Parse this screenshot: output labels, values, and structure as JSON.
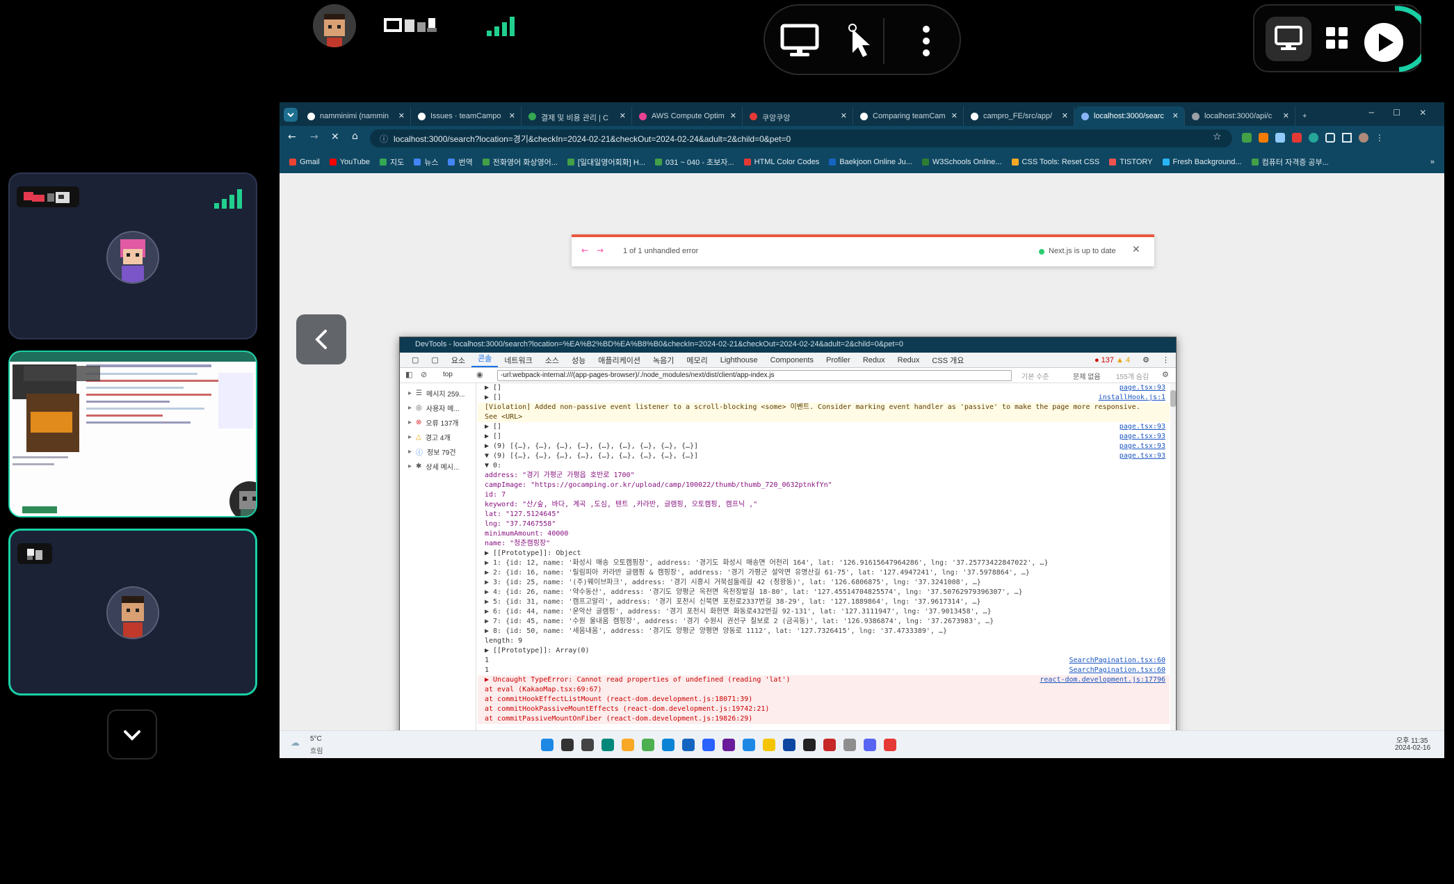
{
  "meeting": {
    "accent": "#19d0a6",
    "signal_color": "#22d08e",
    "controls": [
      {
        "icon": "monitor-icon"
      },
      {
        "icon": "pointer-icon"
      },
      {
        "icon": "more-vertical-icon"
      }
    ],
    "right_controls": [
      {
        "icon": "screen-share-icon"
      },
      {
        "icon": "grid-layout-icon"
      },
      {
        "icon": "play-record-icon"
      }
    ]
  },
  "browser": {
    "tabs": [
      {
        "label": "namminimi (nammin",
        "color": "#ffffff"
      },
      {
        "label": "Issues · teamCampo",
        "color": "#ffffff"
      },
      {
        "label": "결제 및 비용 관리 | C",
        "color": "#34a853"
      },
      {
        "label": "AWS Compute Optim",
        "color": "#e84393"
      },
      {
        "label": "쿠앙쿠앙",
        "color": "#e53935"
      },
      {
        "label": "Comparing teamCam",
        "color": "#ffffff"
      },
      {
        "label": "campro_FE/src/app/",
        "color": "#ffffff"
      },
      {
        "label": "localhost:3000/searc",
        "color": "#8ab4f8"
      },
      {
        "label": "localhost:3000/api/c",
        "color": "#9aa0a6"
      }
    ],
    "url": "localhost:3000/search?location=경기&checkIn=2024-02-21&checkOut=2024-02-24&adult=2&child=0&pet=0",
    "bookmarks": [
      {
        "label": "Gmail",
        "color": "#ea4335"
      },
      {
        "label": "YouTube",
        "color": "#ff0000"
      },
      {
        "label": "지도",
        "color": "#34a853"
      },
      {
        "label": "뉴스",
        "color": "#4285f4"
      },
      {
        "label": "번역",
        "color": "#4285f4"
      },
      {
        "label": "전화영어 화상영어...",
        "color": "#43a047"
      },
      {
        "label": "[일대일영어회화] H...",
        "color": "#43a047"
      },
      {
        "label": "031 ~ 040 - 초보자...",
        "color": "#43a047"
      },
      {
        "label": "HTML Color Codes",
        "color": "#e53935"
      },
      {
        "label": "Baekjoon Online Ju...",
        "color": "#1565c0"
      },
      {
        "label": "W3Schools Online...",
        "color": "#2e7d32"
      },
      {
        "label": "CSS Tools: Reset CSS",
        "color": "#f9a825"
      },
      {
        "label": "TISTORY",
        "color": "#ef5350"
      },
      {
        "label": "Fresh Background...",
        "color": "#29b6f6"
      },
      {
        "label": "컴퓨터 자격증 공부...",
        "color": "#43a047"
      }
    ]
  },
  "nextjs_error": {
    "text": "1 of 1 unhandled error",
    "status": "Next.js is up to date"
  },
  "devtools": {
    "title": "DevTools - localhost:3000/search?location=%EA%B2%BD%EA%B8%B0&checkIn=2024-02-21&checkOut=2024-02-24&adult=2&child=0&pet=0",
    "tabs": [
      "요소",
      "콘솔",
      "네트워크",
      "소스",
      "성능",
      "애플리케이션",
      "녹음기",
      "메모리",
      "Lighthouse",
      "Components",
      "Profiler",
      "Redux",
      "Redux",
      "CSS 개요"
    ],
    "active_tab": "콘솔",
    "error_count": "137",
    "warning_count": "4",
    "context": "top",
    "filter": "-url:webpack-internal:///(app-pages-browser)/./node_modules/next/dist/client/app-index.js",
    "level": "기본 수준",
    "issues": "문제 없음",
    "hidden": "155개 숨김",
    "sidebar": [
      {
        "label": "메시지 259...",
        "icon": "list-icon"
      },
      {
        "label": "사용자 메...",
        "icon": "user-icon"
      },
      {
        "label": "오류 137개",
        "icon": "error-icon"
      },
      {
        "label": "경고 4개",
        "icon": "warning-icon"
      },
      {
        "label": "정보 79건",
        "icon": "info-icon"
      },
      {
        "label": "상세 메시...",
        "icon": "bug-icon"
      }
    ],
    "console_lines": [
      {
        "text": "▶ []",
        "src": "page.tsx:93",
        "cls": ""
      },
      {
        "text": "▶ []",
        "src": "installHook.js:1",
        "cls": ""
      },
      {
        "text": "[Violation] Added non-passive event listener to a scroll-blocking <some> 이벤트. Consider marking event handler as 'passive' to make the page more responsive.",
        "src": "",
        "cls": "warn"
      },
      {
        "text": "See <URL>",
        "src": "",
        "cls": "warn"
      },
      {
        "text": "▶ []",
        "src": "page.tsx:93",
        "cls": ""
      },
      {
        "text": "▶ []",
        "src": "page.tsx:93",
        "cls": ""
      },
      {
        "text": "▶ (9) [{…}, {…}, {…}, {…}, {…}, {…}, {…}, {…}, {…}]",
        "src": "page.tsx:93",
        "cls": ""
      },
      {
        "text": "▼ (9) [{…}, {…}, {…}, {…}, {…}, {…}, {…}, {…}, {…}]",
        "src": "page.tsx:93",
        "cls": ""
      },
      {
        "text": "  ▼ 0:",
        "src": "",
        "cls": ""
      },
      {
        "text": "      address: \"경기 가평군 가평읍 호반로 1700\"",
        "src": "",
        "cls": "obj"
      },
      {
        "text": "      campImage: \"https://gocamping.or.kr/upload/camp/100022/thumb/thumb_720_0632ptnkfYn\"",
        "src": "",
        "cls": "obj"
      },
      {
        "text": "      id: 7",
        "src": "",
        "cls": "obj"
      },
      {
        "text": "      keyword: \"산/숲, 바다, 계곡 ,도심, 텐트 ,카라반, 글램핑, 오토캠핑, 캠프닉 ,\"",
        "src": "",
        "cls": "obj"
      },
      {
        "text": "      lat: \"127.5124645\"",
        "src": "",
        "cls": "obj"
      },
      {
        "text": "      lng: \"37.7467558\"",
        "src": "",
        "cls": "obj"
      },
      {
        "text": "      minimumAmount: 40000",
        "src": "",
        "cls": "obj"
      },
      {
        "text": "      name: \"청춘캠핑장\"",
        "src": "",
        "cls": "obj"
      },
      {
        "text": "    ▶ [[Prototype]]: Object",
        "src": "",
        "cls": ""
      },
      {
        "text": "  ▶ 1: {id: 12, name: '화성시 매송 오토캠핑장', address: '경기도 화성시 매송면 어천리 164', lat: '126.91615647964286', lng: '37.25773422847022', …}",
        "src": "",
        "cls": ""
      },
      {
        "text": "  ▶ 2: {id: 16, name: '릴림피아 카라반 글램핑 & 캠핑장', address: '경기 가평군 설악면 유명산길 61-75', lat: '127.4947241', lng: '37.5978864', …}",
        "src": "",
        "cls": ""
      },
      {
        "text": "  ▶ 3: {id: 25, name: '(주)웨이브파크', address: '경기 시흥시 거북섬둘레길 42 (정왕동)', lat: '126.6806875', lng: '37.3241008', …}",
        "src": "",
        "cls": ""
      },
      {
        "text": "  ▶ 4: {id: 26, name: '약수동산', address: '경기도 양평군 옥천면 옥천장밭길 18-80', lat: '127.45514704825574', lng: '37.50762979396307', …}",
        "src": "",
        "cls": ""
      },
      {
        "text": "  ▶ 5: {id: 31, name: '캠프고알리', address: '경기 포천시 신북면 포천로2337번길 38-29', lat: '127.1889864', lng: '37.9617314', …}",
        "src": "",
        "cls": ""
      },
      {
        "text": "  ▶ 6: {id: 44, name: '운악산 글램핑', address: '경기 포천시 화현면 화동로432번길 92-131', lat: '127.3111947', lng: '37.9013458', …}",
        "src": "",
        "cls": ""
      },
      {
        "text": "  ▶ 7: {id: 45, name: '수원 울내움 캠핑장', address: '경기 수원시 권선구 칠보로 2 (금곡동)', lat: '126.9386874', lng: '37.2673983', …}",
        "src": "",
        "cls": ""
      },
      {
        "text": "  ▶ 8: {id: 50, name: '세움내움', address: '경기도 양평군 양평면 양동로 1112', lat: '127.7326415', lng: '37.4733389', …}",
        "src": "",
        "cls": ""
      },
      {
        "text": "    length: 9",
        "src": "",
        "cls": ""
      },
      {
        "text": "  ▶ [[Prototype]]: Array(0)",
        "src": "",
        "cls": ""
      },
      {
        "text": "1",
        "src": "SearchPagination.tsx:60",
        "cls": ""
      },
      {
        "text": "1",
        "src": "SearchPagination.tsx:60",
        "cls": ""
      },
      {
        "text": "▶ Uncaught TypeError: Cannot read properties of undefined (reading 'lat')",
        "src": "react-dom.development.js:17796",
        "cls": "err"
      },
      {
        "text": "    at eval (KakaoMap.tsx:69:67)",
        "src": "",
        "cls": "err"
      },
      {
        "text": "    at commitHookEffectListMount (react-dom.development.js:18071:39)",
        "src": "",
        "cls": "err"
      },
      {
        "text": "    at commitHookPassiveMountEffects (react-dom.development.js:19742:21)",
        "src": "",
        "cls": "err"
      },
      {
        "text": "    at commitPassiveMountOnFiber (react-dom.development.js:19826:29)",
        "src": "",
        "cls": "err"
      }
    ]
  },
  "taskbar": {
    "weather_temp": "5°C",
    "weather_desc": "흐림",
    "time": "오후 11:35",
    "date": "2024-02-16"
  }
}
